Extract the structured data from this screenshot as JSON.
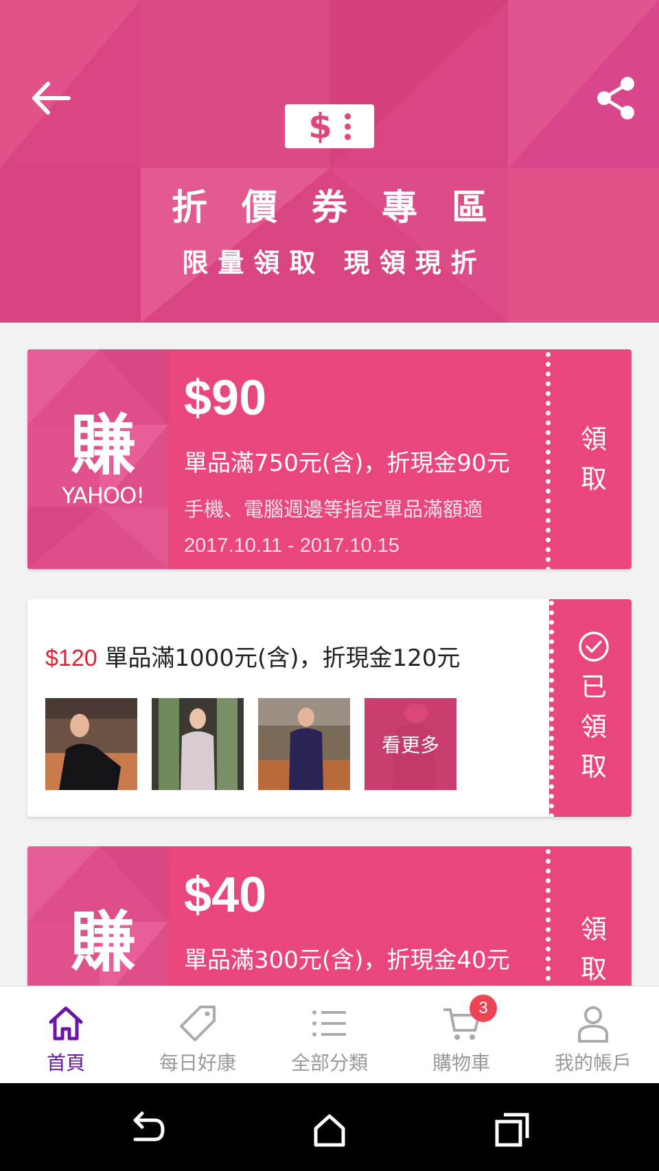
{
  "header": {
    "title": "折價券專區",
    "subtitle": "限量領取  現領現折",
    "logo_text": "$"
  },
  "coupons": [
    {
      "amount": "$90",
      "condition": "單品滿750元(含)，折現金90元",
      "description": "手機、電腦週邊等指定單品滿額適",
      "date_range": "2017.10.11 - 2017.10.15",
      "claim_label_1": "領",
      "claim_label_2": "取",
      "brand_glyph": "賺",
      "brand_name": "YAHOO!"
    },
    {
      "amount": "$120",
      "condition": "單品滿1000元(含)，折現金120元",
      "more_label": "看更多",
      "claimed_1": "已",
      "claimed_2": "領",
      "claimed_3": "取"
    },
    {
      "amount": "$40",
      "condition": "單品滿300元(含)，折現金40元",
      "claim_label_1": "領",
      "claim_label_2": "取",
      "brand_glyph": "賺"
    }
  ],
  "nav": {
    "items": [
      {
        "label": "首頁"
      },
      {
        "label": "每日好康"
      },
      {
        "label": "全部分類"
      },
      {
        "label": "購物車",
        "badge": "3"
      },
      {
        "label": "我的帳戶"
      }
    ]
  },
  "colors": {
    "header_pink": "#d94580",
    "coupon_pink": "#e8467c",
    "active_purple": "#6b15a8",
    "price_red": "#e0212f"
  }
}
